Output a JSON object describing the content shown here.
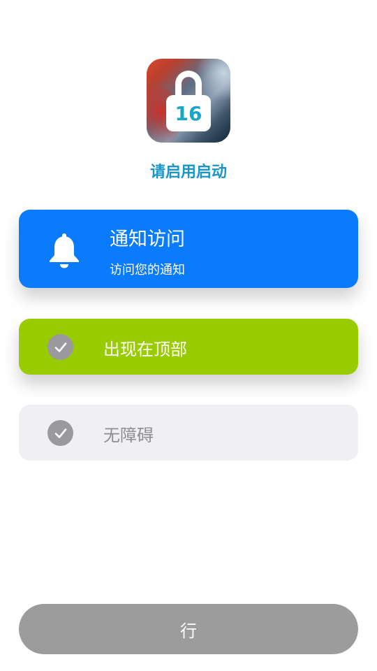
{
  "app": {
    "icon_name": "lock-16-icon",
    "icon_number": "16",
    "title": "请启用启动"
  },
  "notification_card": {
    "icon": "bell-icon",
    "title": "通知访问",
    "subtitle": "访问您的通知",
    "color": "#0a7bfd"
  },
  "options": [
    {
      "label": "出现在顶部",
      "icon": "checkmark-icon",
      "color": "#99cc00"
    },
    {
      "label": "无障碍",
      "icon": "checkmark-icon",
      "color": "#efeff4"
    }
  ],
  "ok_button": {
    "label": "行",
    "color": "#9c9c9c"
  }
}
